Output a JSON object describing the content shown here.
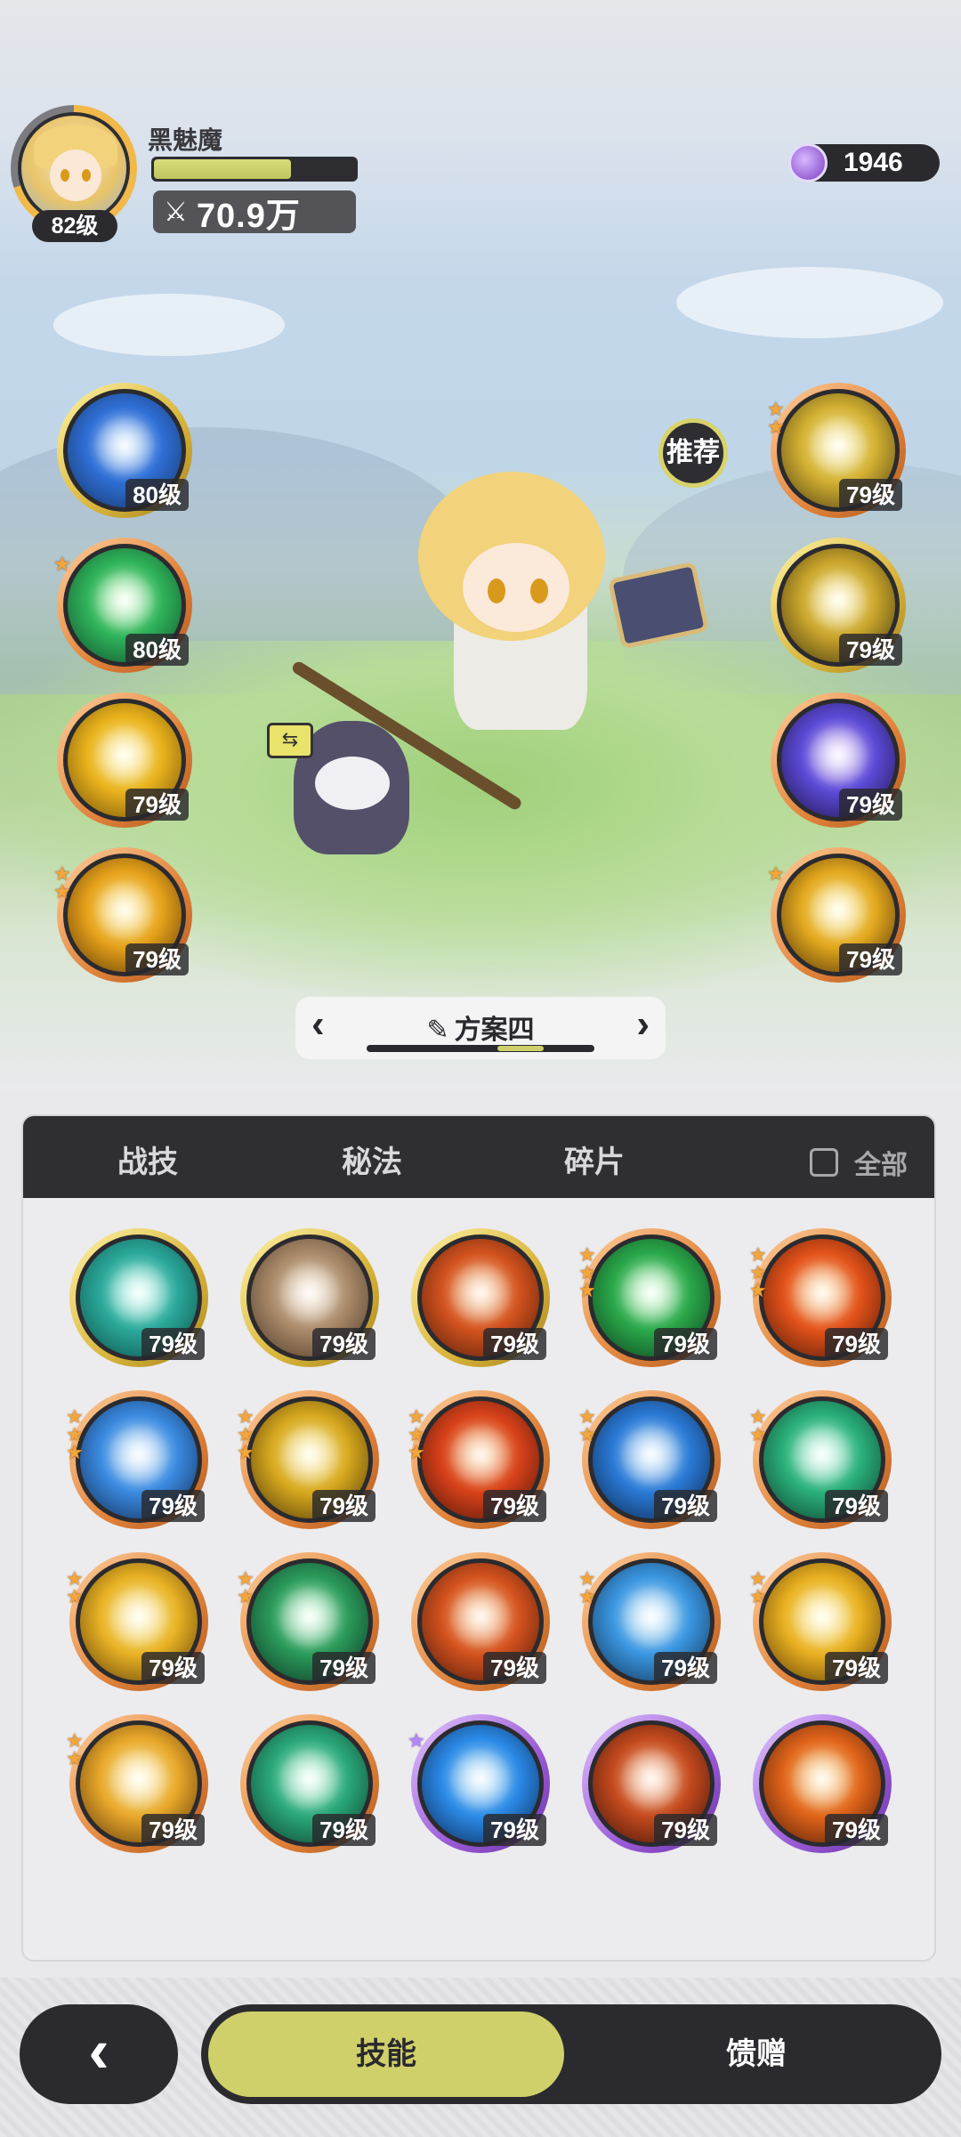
{
  "header": {
    "hero_name": "黑魅魔",
    "hero_level": "82级",
    "hp_fraction": 0.68,
    "power": "70.9万",
    "power_icon": "crossed-swords-icon",
    "currency_value": "1946",
    "currency_icon": "purple-gem-icon"
  },
  "scene": {
    "recommend_label": "推荐",
    "swap_label": "⇆"
  },
  "left_skills": [
    {
      "level": "80级",
      "stars": 0,
      "frame": "gold",
      "art": "ice-burst-icon",
      "colors": [
        "#cfe8ff",
        "#2f6fd6",
        "#14325e"
      ]
    },
    {
      "level": "80级",
      "stars": 1,
      "frame": "orange",
      "art": "green-wind-icon",
      "colors": [
        "#d8ffd0",
        "#2fb35a",
        "#0f4a28"
      ]
    },
    {
      "level": "79级",
      "stars": 0,
      "frame": "orange",
      "art": "lightning-orb-icon",
      "colors": [
        "#fff6b0",
        "#e9b21c",
        "#6a4a08"
      ]
    },
    {
      "level": "79级",
      "stars": 2,
      "frame": "orange",
      "art": "golden-strike-icon",
      "colors": [
        "#fff0a0",
        "#e6a21a",
        "#5a3406"
      ]
    }
  ],
  "right_skills": [
    {
      "level": "79级",
      "stars": 2,
      "frame": "orange",
      "art": "golden-arrow-icon",
      "colors": [
        "#fff4b0",
        "#d2b032",
        "#4a3a10"
      ]
    },
    {
      "level": "79级",
      "stars": 0,
      "frame": "gold",
      "art": "keyhole-icon",
      "colors": [
        "#fff2a8",
        "#c9a52c",
        "#3a300c"
      ]
    },
    {
      "level": "79级",
      "stars": 0,
      "frame": "orange",
      "art": "arcane-clock-icon",
      "colors": [
        "#f0d8ff",
        "#5b4ad6",
        "#1a1240"
      ]
    },
    {
      "level": "79级",
      "stars": 1,
      "frame": "orange",
      "art": "golden-explosion-icon",
      "colors": [
        "#fff3a8",
        "#e2a81e",
        "#4a2c06"
      ]
    }
  ],
  "loadout": {
    "name": "方案四",
    "prev": "‹",
    "next": "›",
    "pen_icon": "✎",
    "position_fraction": 0.72
  },
  "panel": {
    "tabs": [
      "战技",
      "秘法",
      "碎片"
    ],
    "active_tab": 0,
    "all_label": "全部",
    "skills": [
      {
        "level": "79级",
        "stars": 0,
        "frame": "gold",
        "art": "teal-vortex-icon",
        "colors": [
          "#c8fff2",
          "#2aa89a",
          "#0d4a44"
        ]
      },
      {
        "level": "79级",
        "stars": 0,
        "frame": "gold",
        "art": "rock-cards-icon",
        "colors": [
          "#f7e6d0",
          "#a98a6a",
          "#4a3422"
        ]
      },
      {
        "level": "79级",
        "stars": 0,
        "frame": "gold",
        "art": "fire-swirl-icon",
        "colors": [
          "#ffd6a6",
          "#d2521e",
          "#4a1a08"
        ]
      },
      {
        "level": "79级",
        "stars": 3,
        "frame": "orange",
        "art": "green-cross-icon",
        "colors": [
          "#d6ffd6",
          "#2aa84a",
          "#0c3a1a"
        ]
      },
      {
        "level": "79级",
        "stars": 3,
        "frame": "orange",
        "art": "flame-burst-icon",
        "colors": [
          "#ffe0a6",
          "#e2521a",
          "#4a1606"
        ]
      },
      {
        "level": "79级",
        "stars": 3,
        "frame": "orange",
        "art": "ice-shard-icon",
        "colors": [
          "#dff2ff",
          "#3a8ae0",
          "#10284e"
        ]
      },
      {
        "level": "79级",
        "stars": 3,
        "frame": "orange",
        "art": "golden-spire-icon",
        "colors": [
          "#fff4b0",
          "#d6a81e",
          "#4a3206"
        ]
      },
      {
        "level": "79级",
        "stars": 3,
        "frame": "orange",
        "art": "fire-orb-icon",
        "colors": [
          "#ffd8a0",
          "#d8421a",
          "#4a1208"
        ]
      },
      {
        "level": "79级",
        "stars": 2,
        "frame": "orange",
        "art": "water-splash-icon",
        "colors": [
          "#d6efff",
          "#2a7ad6",
          "#0c2448"
        ]
      },
      {
        "level": "79级",
        "stars": 2,
        "frame": "orange",
        "art": "green-slash-icon",
        "colors": [
          "#d6fff0",
          "#2ab07a",
          "#0c3a2a"
        ]
      },
      {
        "level": "79级",
        "stars": 2,
        "frame": "orange",
        "art": "light-burst-icon",
        "colors": [
          "#fff6b8",
          "#e8b224",
          "#5a3a06"
        ]
      },
      {
        "level": "79级",
        "stars": 2,
        "frame": "orange",
        "art": "thorn-vine-icon",
        "colors": [
          "#d6ffe0",
          "#2a9a5a",
          "#0c3020"
        ]
      },
      {
        "level": "79级",
        "stars": 0,
        "frame": "orange",
        "art": "flame-wave-icon",
        "colors": [
          "#ffd8a8",
          "#d4521e",
          "#48180a"
        ]
      },
      {
        "level": "79级",
        "stars": 2,
        "frame": "orange",
        "art": "ice-crystal-icon",
        "colors": [
          "#e0f6ff",
          "#3a96e0",
          "#10304e"
        ]
      },
      {
        "level": "79级",
        "stars": 2,
        "frame": "orange",
        "art": "golden-sun-icon",
        "colors": [
          "#fff6b0",
          "#e8b020",
          "#5a3806"
        ]
      },
      {
        "level": "79级",
        "stars": 2,
        "frame": "orange",
        "art": "star-strike-icon",
        "colors": [
          "#fff6c0",
          "#e8a82a",
          "#5a3408"
        ]
      },
      {
        "level": "79级",
        "stars": 0,
        "frame": "orange",
        "art": "green-orb-icon",
        "colors": [
          "#d6ffe6",
          "#2aa87a",
          "#0c3a2a"
        ]
      },
      {
        "level": "79级",
        "stars": 1,
        "frame": "purple",
        "art": "blue-whirlpool-icon",
        "colors": [
          "#d6f2ff",
          "#2a8ae6",
          "#0c244e"
        ]
      },
      {
        "level": "79级",
        "stars": 0,
        "frame": "purple",
        "art": "meteor-icon",
        "colors": [
          "#ffd6b0",
          "#c44a1e",
          "#3a1008"
        ]
      },
      {
        "level": "79级",
        "stars": 0,
        "frame": "purple",
        "art": "fire-blast-icon",
        "colors": [
          "#ffe6a0",
          "#e0641a",
          "#4a1806"
        ]
      }
    ]
  },
  "bottom_nav": {
    "back_icon": "‹",
    "skill_label": "技能",
    "gift_label": "馈赠"
  }
}
